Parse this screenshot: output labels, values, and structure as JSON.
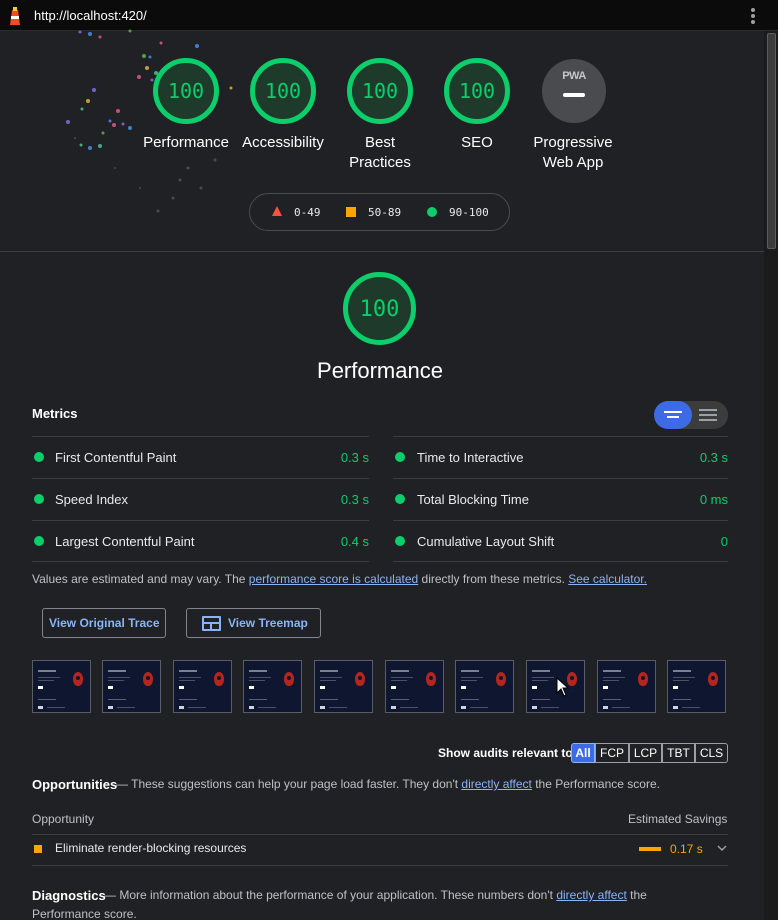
{
  "browser": {
    "url": "http://localhost:420/"
  },
  "gauges": [
    {
      "score": "100",
      "label_lines": [
        "Performance"
      ]
    },
    {
      "score": "100",
      "label_lines": [
        "Accessibility"
      ]
    },
    {
      "score": "100",
      "label_lines": [
        "Best",
        "Practices"
      ]
    },
    {
      "score": "100",
      "label_lines": [
        "SEO"
      ]
    },
    {
      "score": "",
      "label_lines": [
        "Progressive",
        "Web App"
      ]
    }
  ],
  "pwa_badge": "PWA",
  "legend": {
    "fail": "0-49",
    "average": "50-89",
    "pass": "90-100"
  },
  "performance": {
    "score": "100",
    "title": "Performance",
    "metrics_heading": "Metrics",
    "metrics": [
      {
        "name": "First Contentful Paint",
        "value": "0.3 s"
      },
      {
        "name": "Time to Interactive",
        "value": "0.3 s"
      },
      {
        "name": "Speed Index",
        "value": "0.3 s"
      },
      {
        "name": "Total Blocking Time",
        "value": "0 ms"
      },
      {
        "name": "Largest Contentful Paint",
        "value": "0.4 s"
      },
      {
        "name": "Cumulative Layout Shift",
        "value": "0"
      }
    ],
    "note_prefix": "Values are estimated and may vary. The ",
    "note_link1": "performance score is calculated",
    "note_middle": " directly from these metrics. ",
    "note_link2": "See calculator."
  },
  "buttons": {
    "trace": "View Original Trace",
    "treemap": "View Treemap"
  },
  "filmstrip_count": 10,
  "filter": {
    "label": "Show audits relevant to:",
    "options": [
      "All",
      "FCP",
      "LCP",
      "TBT",
      "CLS"
    ]
  },
  "opportunities": {
    "title": "Opportunities",
    "desc_prefix": "— These suggestions can help your page load faster. They don't ",
    "desc_link": "directly affect",
    "desc_suffix": " the Performance score.",
    "col_opportunity": "Opportunity",
    "col_savings": "Estimated Savings",
    "items": [
      {
        "name": "Eliminate render-blocking resources",
        "savings": "0.17 s"
      }
    ]
  },
  "diagnostics": {
    "title": "Diagnostics",
    "desc_prefix": "— More information about the performance of your application. These numbers don't ",
    "desc_link": "directly affect",
    "desc_suffix": " the",
    "desc_line2": "Performance score."
  },
  "colors": {
    "pass": "#0cce6b",
    "average": "#ffa400",
    "fail": "#ff4e42",
    "link": "#8ab4f8",
    "accent": "#3d6be6"
  }
}
